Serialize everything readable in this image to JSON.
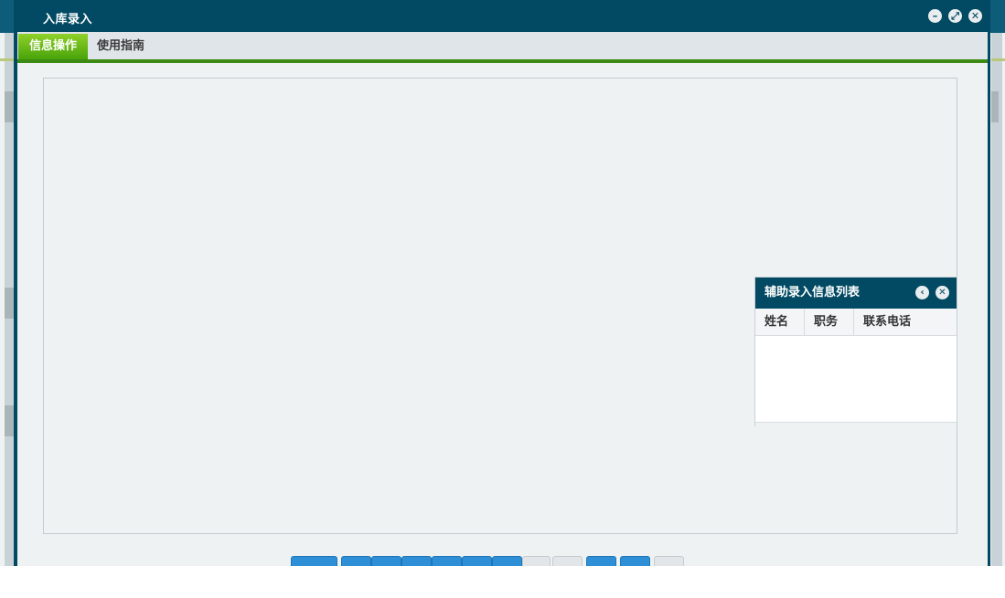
{
  "window": {
    "title": "入库录入",
    "controls": {
      "minimize_icon": "minus-icon",
      "maximize_icon": "expand-icon",
      "close_icon": "close-icon"
    }
  },
  "tabs": [
    {
      "label": "信息操作",
      "active": true
    },
    {
      "label": "使用指南",
      "active": false
    }
  ],
  "helper_panel": {
    "title": "辅助录入信息列表",
    "columns": [
      "姓名",
      "职务",
      "联系电话"
    ],
    "rows": [],
    "icons": {
      "collapse": "chevron-left-icon",
      "close": "close-icon"
    }
  },
  "toolbar": {
    "buttons": [
      "blue",
      "blue",
      "blue",
      "blue",
      "blue",
      "blue",
      "blue",
      "gray",
      "gray",
      "blue",
      "blue",
      "gray"
    ]
  },
  "colors": {
    "title_bar": "#024a63",
    "active_tab": "#5fb514",
    "tab_underline": "#3d8b12",
    "button_blue": "#2e8fd6"
  }
}
